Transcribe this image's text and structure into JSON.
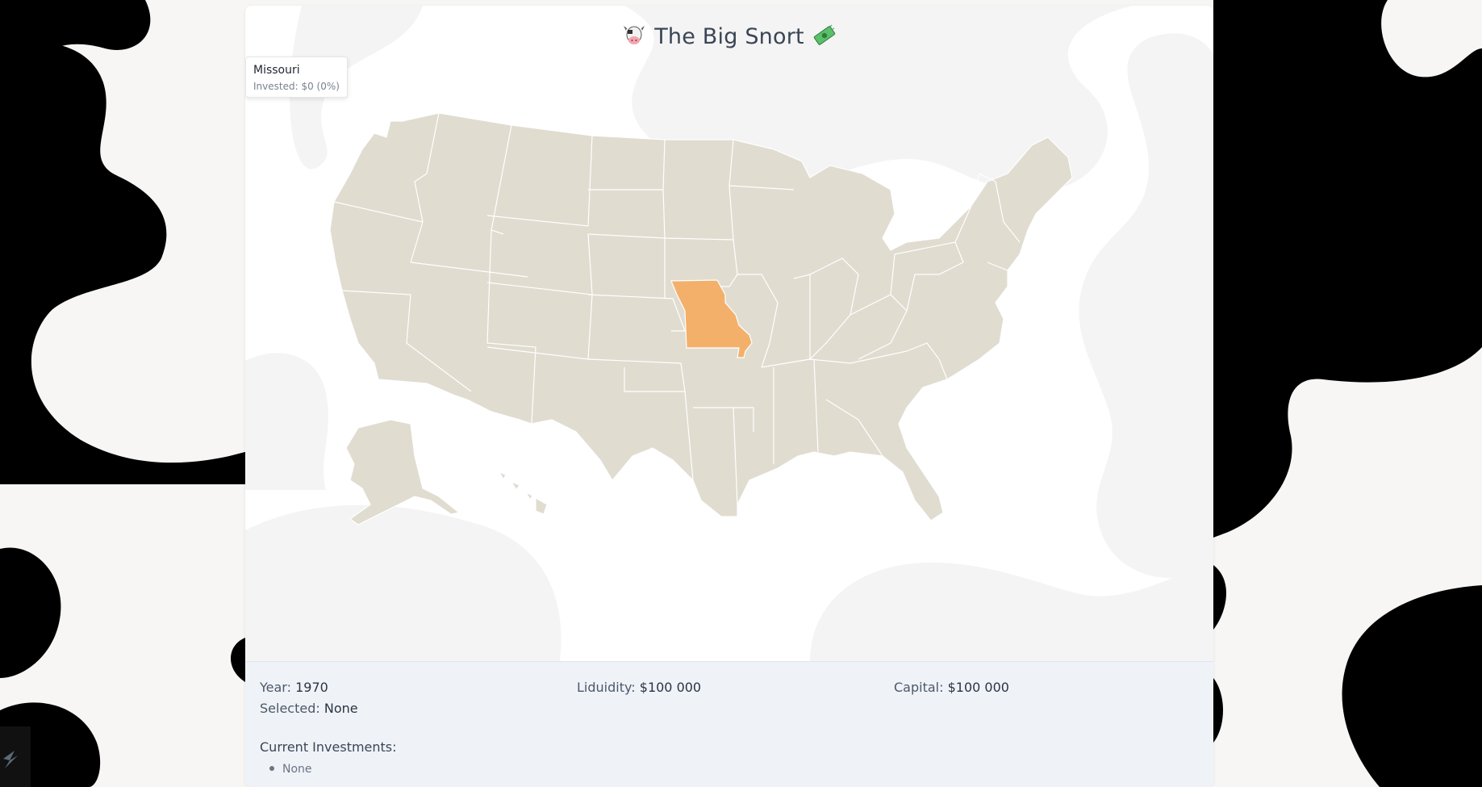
{
  "app": {
    "title": "The Big Snort",
    "title_icons": [
      "cow-icon",
      "money-icon"
    ]
  },
  "tooltip": {
    "state": "Missouri",
    "invested_label": "Invested: $0 (0%)"
  },
  "map": {
    "selected_state": "Missouri",
    "highlight_color": "#f3b06a",
    "state_fill": "#e0dcd0",
    "state_stroke": "#ffffff"
  },
  "stats": {
    "year_label": "Year:",
    "year_value": "1970",
    "liquidity_label": "Liduidity:",
    "liquidity_value": "$100 000",
    "capital_label": "Capital:",
    "capital_value": "$100 000",
    "selected_label": "Selected:",
    "selected_value": "None"
  },
  "investments": {
    "heading": "Current Investments:",
    "items": [
      "None"
    ]
  },
  "colors": {
    "background": "#f7f6f4",
    "cow_spots": "#000000",
    "panel": "#eff3f8",
    "accent": "#f3b06a"
  }
}
